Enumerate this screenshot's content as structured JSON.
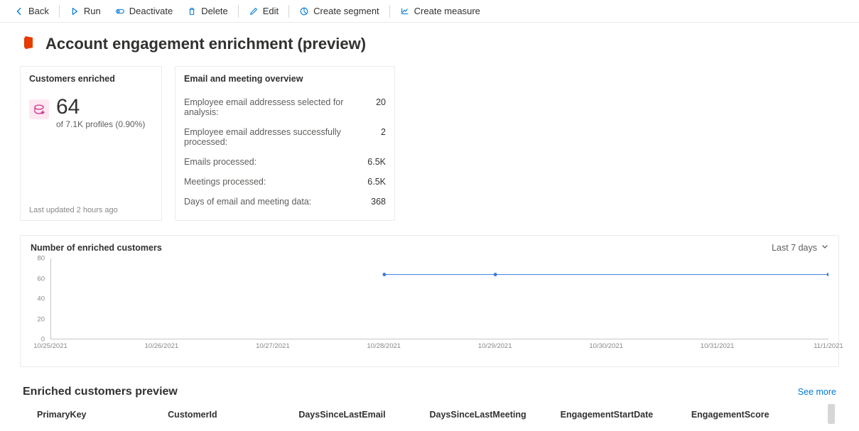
{
  "toolbar": {
    "back": "Back",
    "run": "Run",
    "deactivate": "Deactivate",
    "delete": "Delete",
    "edit": "Edit",
    "create_segment": "Create segment",
    "create_measure": "Create measure"
  },
  "page_title": "Account engagement enrichment (preview)",
  "enriched_card": {
    "title": "Customers enriched",
    "count": "64",
    "subtitle": "of 7.1K profiles (0.90%)",
    "footer": "Last updated 2 hours ago"
  },
  "overview_card": {
    "title": "Email and meeting overview",
    "rows": [
      {
        "label": "Employee email addressess selected for analysis:",
        "value": "20"
      },
      {
        "label": "Employee email addresses successfully processed:",
        "value": "2"
      },
      {
        "label": "Emails processed:",
        "value": "6.5K"
      },
      {
        "label": "Meetings processed:",
        "value": "6.5K"
      },
      {
        "label": "Days of email and meeting data:",
        "value": "368"
      }
    ]
  },
  "chart": {
    "title": "Number of enriched customers",
    "range_label": "Last 7 days"
  },
  "chart_data": {
    "type": "line",
    "title": "Number of enriched customers",
    "xlabel": "",
    "ylabel": "",
    "ylim": [
      0,
      80
    ],
    "y_ticks": [
      0,
      20,
      40,
      60,
      80
    ],
    "categories": [
      "10/25/2021",
      "10/26/2021",
      "10/27/2021",
      "10/28/2021",
      "10/29/2021",
      "10/30/2021",
      "10/31/2021",
      "11/1/2021"
    ],
    "series": [
      {
        "name": "Enriched customers",
        "values": [
          null,
          null,
          null,
          64,
          64,
          null,
          null,
          64
        ]
      }
    ]
  },
  "preview": {
    "title": "Enriched customers preview",
    "see_more": "See more",
    "columns": [
      "PrimaryKey",
      "CustomerId",
      "DaysSinceLastEmail",
      "DaysSinceLastMeeting",
      "EngagementStartDate",
      "EngagementScore"
    ]
  }
}
